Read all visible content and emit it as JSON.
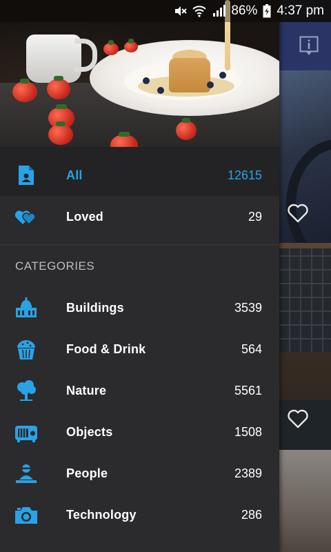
{
  "status_bar": {
    "battery": "86%",
    "time": "4:37 pm",
    "icons": [
      "mute-icon",
      "wifi-icon",
      "signal-icon",
      "battery-icon"
    ]
  },
  "drawer": {
    "hero_image": "food-photo",
    "primary": [
      {
        "label": "All",
        "count": "12615",
        "icon": "document-person-icon",
        "active": true
      },
      {
        "label": "Loved",
        "count": "29",
        "icon": "hearts-icon",
        "active": false
      }
    ],
    "categories_header": "CATEGORIES",
    "categories": [
      {
        "label": "Buildings",
        "count": "3539",
        "icon": "building-icon"
      },
      {
        "label": "Food & Drink",
        "count": "564",
        "icon": "muffin-icon"
      },
      {
        "label": "Nature",
        "count": "5561",
        "icon": "tree-icon"
      },
      {
        "label": "Objects",
        "count": "1508",
        "icon": "radio-icon"
      },
      {
        "label": "People",
        "count": "2389",
        "icon": "person-icon"
      },
      {
        "label": "Technology",
        "count": "286",
        "icon": "camera-icon"
      }
    ]
  },
  "colors": {
    "accent": "#29a3e6",
    "drawer_bg": "#2b2b2d",
    "active_row_bg": "#232325",
    "topbar": "#2a3566"
  }
}
